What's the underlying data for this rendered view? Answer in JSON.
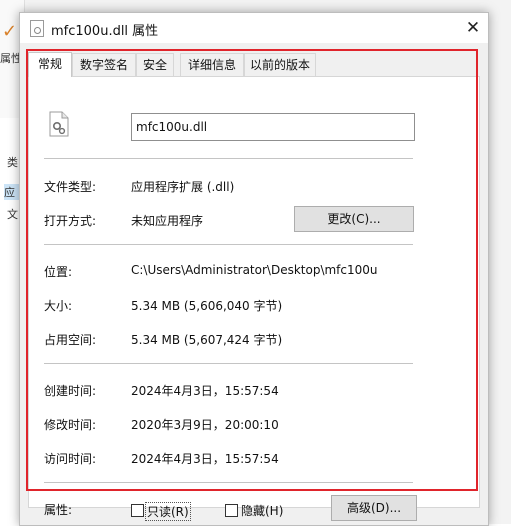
{
  "background": {
    "side_label": "属性",
    "list_col_1": "类",
    "list_col_2": "应",
    "list_col_3": "文"
  },
  "dialog": {
    "title": "mfc100u.dll 属性",
    "close_glyph": "✕"
  },
  "tabs": [
    {
      "label": "常规",
      "active": true
    },
    {
      "label": "数字签名",
      "active": false
    },
    {
      "label": "安全",
      "active": false
    },
    {
      "label": "详细信息",
      "active": false
    },
    {
      "label": "以前的版本",
      "active": false
    }
  ],
  "general": {
    "file_name": "mfc100u.dll",
    "file_type_label": "文件类型:",
    "file_type_value": "应用程序扩展 (.dll)",
    "open_with_label": "打开方式:",
    "open_with_value": "未知应用程序",
    "change_button": "更改(C)...",
    "location_label": "位置:",
    "location_value": "C:\\Users\\Administrator\\Desktop\\mfc100u",
    "size_label": "大小:",
    "size_value": "5.34 MB (5,606,040 字节)",
    "size_on_disk_label": "占用空间:",
    "size_on_disk_value": "5.34 MB (5,607,424 字节)",
    "created_label": "创建时间:",
    "created_value": "2024年4月3日，15:57:54",
    "modified_label": "修改时间:",
    "modified_value": "2020年3月9日，20:00:10",
    "accessed_label": "访问时间:",
    "accessed_value": "2024年4月3日，15:57:54",
    "attributes_label": "属性:",
    "readonly_label": "只读(R)",
    "readonly_checked": false,
    "hidden_label": "隐藏(H)",
    "hidden_checked": false,
    "advanced_button": "高级(D)..."
  },
  "colors": {
    "highlight": "#e0242b",
    "dialog_bg": "#f0f0f0",
    "panel_bg": "#ffffff"
  }
}
